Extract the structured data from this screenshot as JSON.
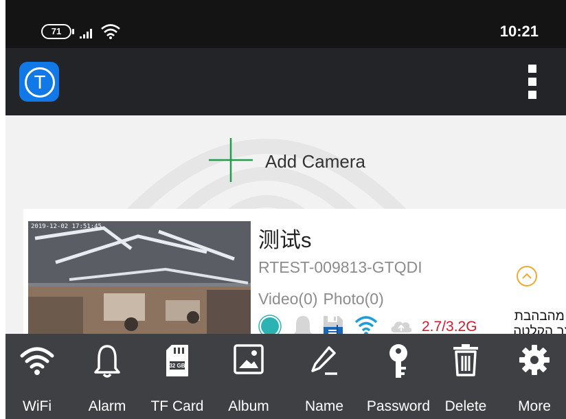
{
  "status_bar": {
    "battery": "71",
    "time": "10:21"
  },
  "app_bar": {
    "logo_letter": "T"
  },
  "add_camera": {
    "label": "Add Camera"
  },
  "camera": {
    "name": "测试s",
    "id": "RTEST-009813-GTQDI",
    "video": "Video(0)",
    "photo": "Photo(0)",
    "storage": "2.7/3.2G",
    "thumbnail_timestamp": "2019-12-02 17:51:45"
  },
  "annotation": {
    "line1": "י מהבהבת",
    "line2": "צב הקלטה"
  },
  "bottom_nav": [
    {
      "label": "WiFi",
      "icon": "wifi-icon"
    },
    {
      "label": "Alarm",
      "icon": "bell-icon"
    },
    {
      "label": "TF Card",
      "icon": "sd-card-icon"
    },
    {
      "label": "Album",
      "icon": "image-icon"
    },
    {
      "label": "Name",
      "icon": "pencil-icon"
    },
    {
      "label": "Password",
      "icon": "key-icon"
    },
    {
      "label": "Delete",
      "icon": "trash-icon"
    },
    {
      "label": "More",
      "icon": "gear-icon"
    }
  ],
  "colors": {
    "accent_green": "#1e9e4a",
    "storage_red": "#d51a2c",
    "wifi_blue": "#1a9fd8",
    "online_teal": "#2bb3b3",
    "expand_orange": "#f0a830"
  }
}
